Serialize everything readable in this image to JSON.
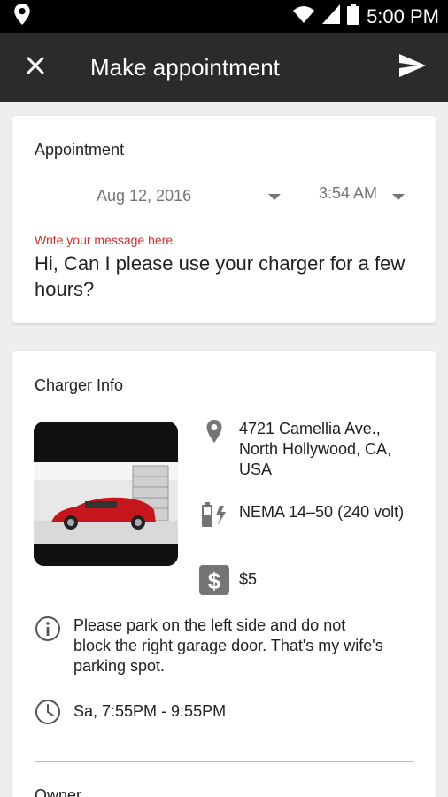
{
  "status_bar": {
    "time": "5:00 PM"
  },
  "app_bar": {
    "title": "Make appointment"
  },
  "appointment": {
    "title": "Appointment",
    "date": "Aug 12, 2016",
    "time": "3:54 AM",
    "message_label": "Write your message here",
    "message": "Hi, Can I please use your charger for a few hours?"
  },
  "charger_info": {
    "title": "Charger Info",
    "address": "4721 Camellia Ave., North Hollywood, CA, USA",
    "plug": "NEMA 14–50 (240 volt)",
    "price": "$5",
    "price_icon_symbol": "$",
    "note": "Please park on the left side and do not block the right garage door. That's my wife's parking spot.",
    "hours": "Sa, 7:55PM - 9:55PM"
  },
  "owner": {
    "title": "Owner"
  },
  "colors": {
    "app_bar": "#2b2b2b",
    "accent_red": "#d32f2f",
    "icon_gray": "#757575"
  }
}
